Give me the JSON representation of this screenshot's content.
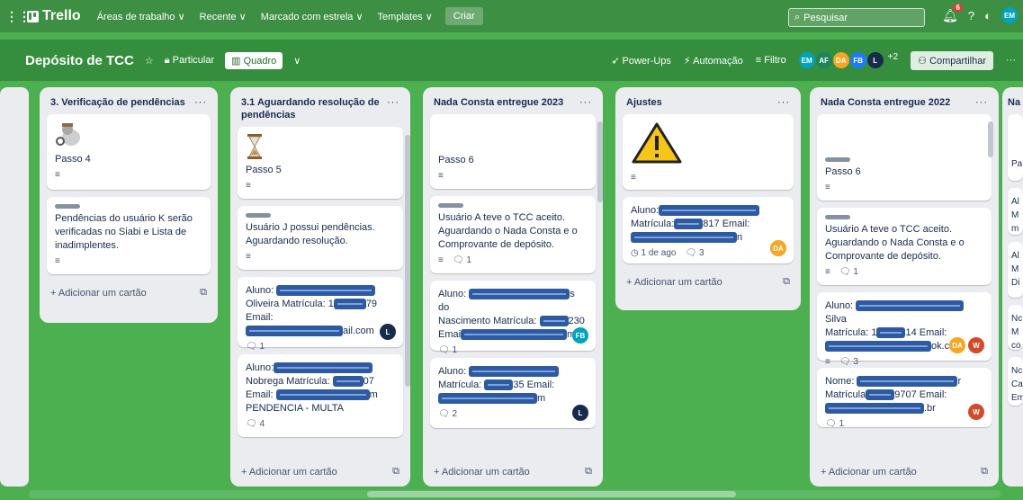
{
  "topbar": {
    "brand": "Trello",
    "nav": [
      "Áreas de trabalho ∨",
      "Recente ∨",
      "Marcado com estrela ∨",
      "Templates ∨"
    ],
    "create": "Criar",
    "search_placeholder": "Pesquisar",
    "notif_count": "6",
    "me": "EM"
  },
  "board": {
    "title": "Depósito de TCC",
    "visibility": "Particular",
    "view": "Quadro",
    "powerups": "Power-Ups",
    "automation": "Automação",
    "filter": "Filtro",
    "members": [
      "EM",
      "AF",
      "DA",
      "FB",
      "L"
    ],
    "more_members": "+2",
    "share": "Compartilhar"
  },
  "add_card": "+ Adicionar um cartão",
  "lists": [
    {
      "title": "3. Verificação de pendências",
      "cards": [
        {
          "title": "Passo 4"
        },
        {
          "title": "Pendências do usuário K serão verificadas no Siabi e Lista de inadimplentes."
        }
      ]
    },
    {
      "title": "3.1 Aguardando resolução de pendências",
      "cards": [
        {
          "title": "Passo 5"
        },
        {
          "title": "Usuário J possui pendências. Aguardando resolução."
        },
        {
          "t1": "Aluno:",
          "t2": "Oliveira Matrícula: 1",
          "t3": "79 Email:",
          "t4": "ail.com",
          "comments": "1",
          "member": "L"
        },
        {
          "t1": "Aluno:",
          "t2": "Nobrega Matrícula:",
          "t3": "07",
          "t4": "Email:",
          "t5": "m",
          "t6": "PENDENCIA - MULTA",
          "comments": "4"
        }
      ]
    },
    {
      "title": "Nada Consta entregue 2023",
      "cards": [
        {
          "title": "Passo 6"
        },
        {
          "title": "Usuário A teve o TCC aceito. Aguardando o Nada Consta e o Comprovante de depósito.",
          "comments": "1"
        },
        {
          "t1": "Aluno:",
          "t2": "s do",
          "t3": "Nascimento Matrícula:",
          "t4": "230",
          "t5": "Emai",
          "t6": "m",
          "comments": "1",
          "member": "FB"
        },
        {
          "t1": "Aluno:",
          "t2": "Matrícula:",
          "t3": "35 Email:",
          "t4": "m",
          "comments": "2",
          "member": "L"
        }
      ]
    },
    {
      "title": "Ajustes",
      "cards": [
        {
          "t1": "Aluno:",
          "t2": "Matrícula:",
          "t3": "817 Email:",
          "t4": "n",
          "due": "1 de ago",
          "comments": "3",
          "member": "DA"
        }
      ]
    },
    {
      "title": "Nada Consta entregue 2022",
      "cards": [
        {
          "title": "Passo 6"
        },
        {
          "title": "Usuário A teve o TCC aceito. Aguardando o Nada Consta e o Comprovante de depósito.",
          "comments": "1"
        },
        {
          "t1": "Aluno:",
          "t2": "Silva",
          "t3": "Matrícula: 1",
          "t4": "14 Email:",
          "t5": "ok.com",
          "comments": "3",
          "members": [
            "DA",
            "W"
          ]
        },
        {
          "t1": "Nome:",
          "t2": "r",
          "t3": "Matrícula",
          "t4": "9707 Email:",
          "t5": ".br",
          "comments": "1",
          "member": "W"
        }
      ]
    },
    {
      "title": "Na",
      "cards": [
        {
          "title": "Pa"
        },
        {
          "title": "Al M m"
        },
        {
          "title": "Al M Di"
        },
        {
          "title": "Nc M co"
        },
        {
          "title": "Nc Ca Em"
        }
      ]
    }
  ],
  "colors": {
    "bg": "#4caf50",
    "header": "#3d8f43",
    "boardbar": "#348e3d",
    "list": "#ebecf0",
    "redact": "#2e5aa2"
  }
}
